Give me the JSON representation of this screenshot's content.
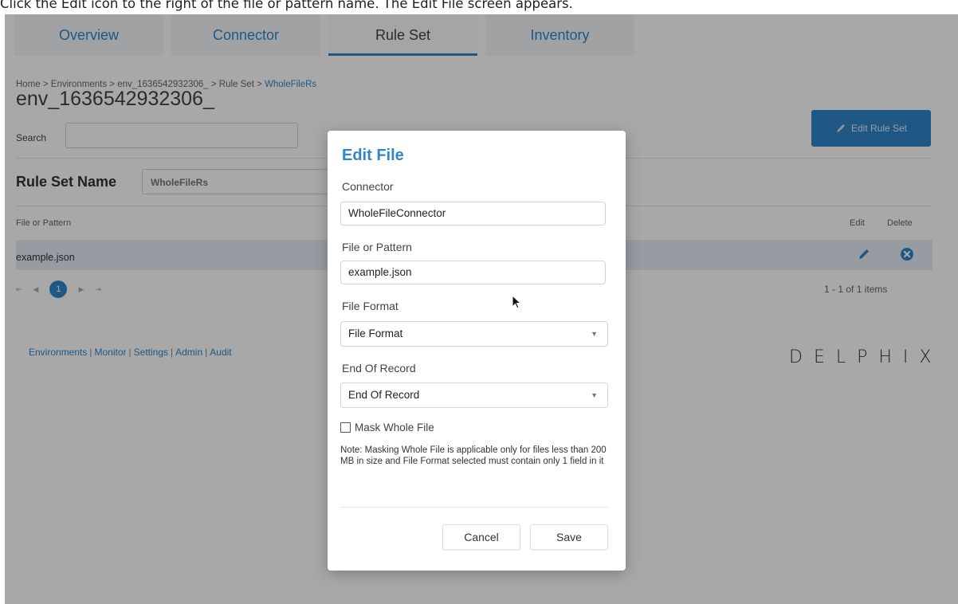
{
  "caption": "Click the Edit icon to the right of the file or pattern name. The Edit File screen appears.",
  "tabs": [
    {
      "label": "Overview"
    },
    {
      "label": "Connector"
    },
    {
      "label": "Rule Set"
    },
    {
      "label": "Inventory"
    }
  ],
  "active_tab": "Rule Set",
  "breadcrumb": {
    "path": "Home > Environments > env_1636542932306_ > Rule Set > ",
    "current": "WholeFileRs"
  },
  "environment_title": "env_1636542932306_",
  "search": {
    "label": "Search",
    "value": ""
  },
  "edit_rule_set_button": "Edit Rule Set",
  "rule_set": {
    "label": "Rule Set Name",
    "value": "WholeFileRs"
  },
  "table": {
    "headers": {
      "file": "File or Pattern",
      "edit": "Edit",
      "delete": "Delete"
    },
    "rows": [
      {
        "file": "example.json"
      }
    ]
  },
  "pagination": {
    "first": "⇤",
    "prev": "◀",
    "current": "1",
    "next": "▶",
    "last": "⇥",
    "summary": "1 - 1 of 1 items"
  },
  "footer_links": [
    "Environments",
    "Monitor",
    "Settings",
    "Admin",
    "Audit"
  ],
  "logo_text": "DELPHIX",
  "modal": {
    "title": "Edit File",
    "connector": {
      "label": "Connector",
      "value": "WholeFileConnector"
    },
    "file_or_pattern": {
      "label": "File or Pattern",
      "value": "example.json"
    },
    "file_format": {
      "label": "File Format",
      "selected": "File Format"
    },
    "end_of_record": {
      "label": "End Of Record",
      "selected": "End Of Record"
    },
    "mask_whole_file": {
      "label": "Mask Whole File",
      "checked": false
    },
    "note": "Note: Masking Whole File is applicable only for files less than 200 MB in size and File Format selected must contain only 1 field in it",
    "cancel_label": "Cancel",
    "save_label": "Save"
  },
  "colors": {
    "accent": "#2f86c9",
    "overlay": "rgba(0,0,0,0.34)"
  }
}
